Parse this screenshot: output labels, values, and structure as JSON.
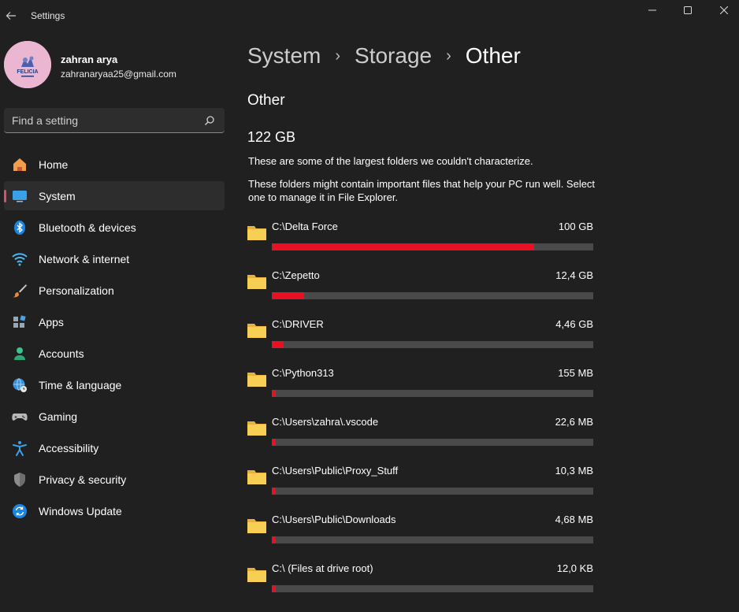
{
  "window": {
    "title": "Settings"
  },
  "user": {
    "name": "zahran arya",
    "email": "zahranaryaa25@gmail.com",
    "avatar_text": "FELICIA"
  },
  "search": {
    "placeholder": "Find a setting"
  },
  "nav": [
    {
      "label": "Home",
      "icon": "home-icon",
      "selected": false
    },
    {
      "label": "System",
      "icon": "system-icon",
      "selected": true
    },
    {
      "label": "Bluetooth & devices",
      "icon": "bluetooth-icon",
      "selected": false
    },
    {
      "label": "Network & internet",
      "icon": "wifi-icon",
      "selected": false
    },
    {
      "label": "Personalization",
      "icon": "brush-icon",
      "selected": false
    },
    {
      "label": "Apps",
      "icon": "apps-icon",
      "selected": false
    },
    {
      "label": "Accounts",
      "icon": "person-icon",
      "selected": false
    },
    {
      "label": "Time & language",
      "icon": "globe-clock-icon",
      "selected": false
    },
    {
      "label": "Gaming",
      "icon": "gamepad-icon",
      "selected": false
    },
    {
      "label": "Accessibility",
      "icon": "accessibility-icon",
      "selected": false
    },
    {
      "label": "Privacy & security",
      "icon": "shield-icon",
      "selected": false
    },
    {
      "label": "Windows Update",
      "icon": "update-icon",
      "selected": false
    }
  ],
  "breadcrumb": {
    "items": [
      "System",
      "Storage"
    ],
    "current": "Other",
    "separator": "›"
  },
  "main": {
    "title": "Other",
    "total": "122 GB",
    "description": "These are some of the largest folders we couldn't characterize.",
    "description2": "These folders might contain important files that help your PC run well. Select one to manage it in File Explorer."
  },
  "folders": [
    {
      "path": "C:\\Delta Force",
      "size": "100 GB",
      "fraction": 0.817
    },
    {
      "path": "C:\\Zepetto",
      "size": "12,4 GB",
      "fraction": 0.101
    },
    {
      "path": "C:\\DRIVER",
      "size": "4,46 GB",
      "fraction": 0.037
    },
    {
      "path": "C:\\Python313",
      "size": "155 MB",
      "fraction": 0.012
    },
    {
      "path": "C:\\Users\\zahra\\.vscode",
      "size": "22,6 MB",
      "fraction": 0.012
    },
    {
      "path": "C:\\Users\\Public\\Proxy_Stuff",
      "size": "10,3 MB",
      "fraction": 0.012
    },
    {
      "path": "C:\\Users\\Public\\Downloads",
      "size": "4,68 MB",
      "fraction": 0.012
    },
    {
      "path": "C:\\ (Files at drive root)",
      "size": "12,0 KB",
      "fraction": 0.012
    }
  ],
  "colors": {
    "accent": "#e04d6a",
    "bar_fill": "#e81123",
    "bar_track": "#4a4a4a",
    "background": "#202020",
    "folder": "#f6c94b"
  }
}
